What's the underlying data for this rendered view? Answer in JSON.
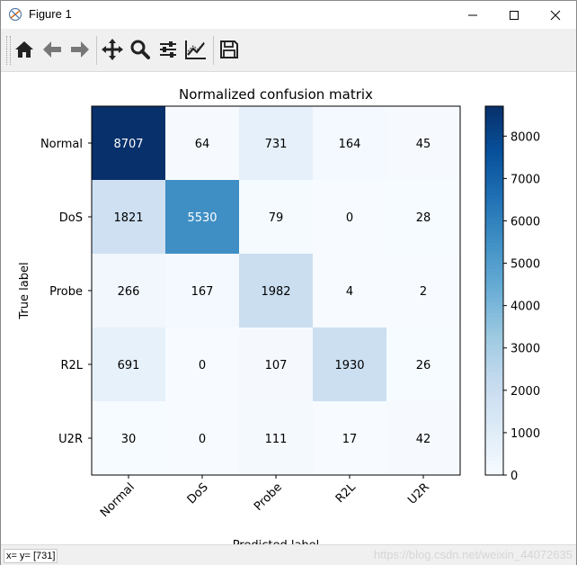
{
  "window": {
    "title": "Figure 1"
  },
  "toolbar": {
    "buttons": [
      {
        "name": "home-button",
        "icon": "home-icon"
      },
      {
        "name": "back-button",
        "icon": "arrow-left-icon"
      },
      {
        "name": "forward-button",
        "icon": "arrow-right-icon"
      },
      {
        "name": "pan-button",
        "icon": "move-icon"
      },
      {
        "name": "zoom-button",
        "icon": "magnifier-icon"
      },
      {
        "name": "subplots-button",
        "icon": "sliders-icon"
      },
      {
        "name": "axes-edit-button",
        "icon": "line-chart-icon"
      },
      {
        "name": "save-button",
        "icon": "floppy-disk-icon"
      }
    ]
  },
  "status": {
    "text": "x= y= [731]",
    "watermark": "https://blog.csdn.net/weixin_44072635"
  },
  "colors": {
    "cmap_low": "#f7fbff",
    "cmap_high": "#08306b",
    "text_dark_bg": "#ffffff",
    "text_light_bg": "#000000"
  },
  "chart_data": {
    "type": "heatmap",
    "title": "Normalized confusion matrix",
    "xlabel": "Predicted label",
    "ylabel": "True label",
    "x_categories": [
      "Normal",
      "DoS",
      "Probe",
      "R2L",
      "U2R"
    ],
    "y_categories": [
      "Normal",
      "DoS",
      "Probe",
      "R2L",
      "U2R"
    ],
    "values": [
      [
        8707,
        64,
        731,
        164,
        45
      ],
      [
        1821,
        5530,
        79,
        0,
        28
      ],
      [
        266,
        167,
        1982,
        4,
        2
      ],
      [
        691,
        0,
        107,
        1930,
        26
      ],
      [
        30,
        0,
        111,
        17,
        42
      ]
    ],
    "colorbar": {
      "min": 0,
      "max": 8707,
      "ticks": [
        0,
        1000,
        2000,
        3000,
        4000,
        5000,
        6000,
        7000,
        8000
      ]
    },
    "colormap": "Blues"
  }
}
